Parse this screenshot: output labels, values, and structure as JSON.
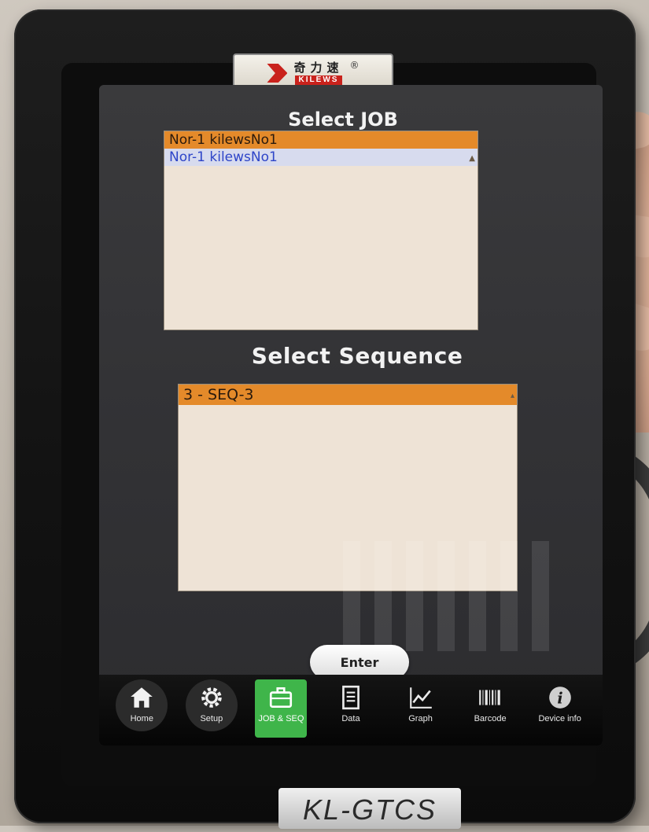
{
  "device": {
    "logo_cn": "奇力速",
    "logo_en": "KILEWS",
    "logo_reg": "®",
    "model": "KL-GTCS"
  },
  "job_section": {
    "title": "Select JOB",
    "items": [
      {
        "label": "Nor-1 kilewsNo1",
        "state": "selected"
      },
      {
        "label": "Nor-1 kilewsNo1",
        "state": "highlighted"
      }
    ]
  },
  "sequence_section": {
    "title": "Select Sequence",
    "items": [
      {
        "label": "3 - SEQ-3",
        "state": "selected"
      }
    ]
  },
  "actions": {
    "enter_label": "Enter"
  },
  "nav": {
    "items": [
      {
        "label": "Home",
        "icon": "home-icon"
      },
      {
        "label": "Setup",
        "icon": "gear-icon"
      },
      {
        "label": "JOB & SEQ",
        "icon": "briefcase-icon",
        "active": true
      },
      {
        "label": "Data",
        "icon": "document-icon"
      },
      {
        "label": "Graph",
        "icon": "graph-icon"
      },
      {
        "label": "Barcode",
        "icon": "barcode-icon"
      },
      {
        "label": "Device info",
        "icon": "info-icon"
      }
    ]
  },
  "colors": {
    "selected_row": "#e48a2a",
    "highlight_row": "#d7dbee",
    "highlight_text": "#2e45c8",
    "active_nav": "#3fb54a",
    "screen_bg": "#333336",
    "list_bg": "#eee3d6"
  }
}
